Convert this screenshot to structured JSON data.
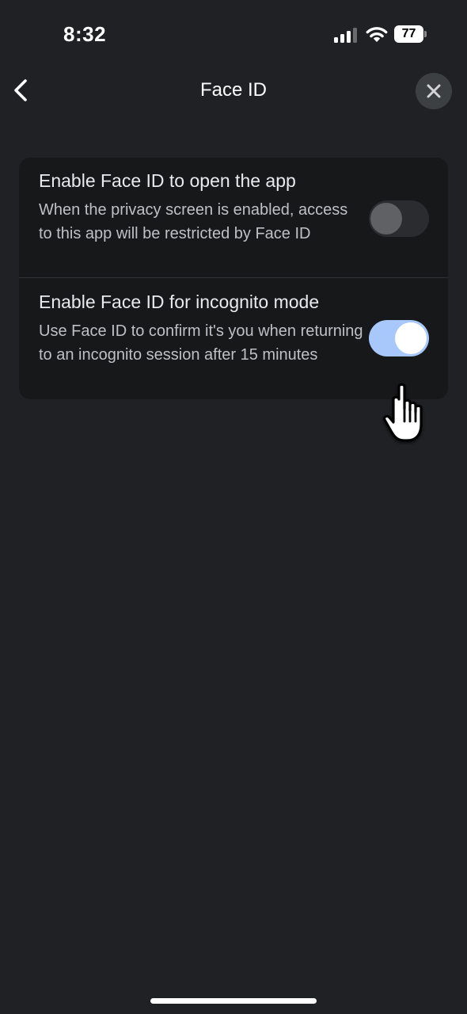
{
  "status_bar": {
    "time": "8:32",
    "battery_level": "77",
    "icons": [
      "signal-icon",
      "wifi-icon",
      "battery-icon"
    ]
  },
  "nav": {
    "title": "Face ID",
    "back_icon": "chevron-left-icon",
    "close_icon": "close-icon"
  },
  "settings": [
    {
      "title": "Enable Face ID to open the app",
      "description": "When the privacy screen is enabled, access to this app will be restricted by Face ID",
      "enabled": false
    },
    {
      "title": "Enable Face ID for incognito mode",
      "description": "Use Face ID to confirm it's you when returning to an incognito session after 15 minutes",
      "enabled": true
    }
  ],
  "colors": {
    "background": "#202124",
    "card": "#17181a",
    "toggle_on": "#a8c7fa",
    "toggle_off": "#2b2c2f"
  }
}
